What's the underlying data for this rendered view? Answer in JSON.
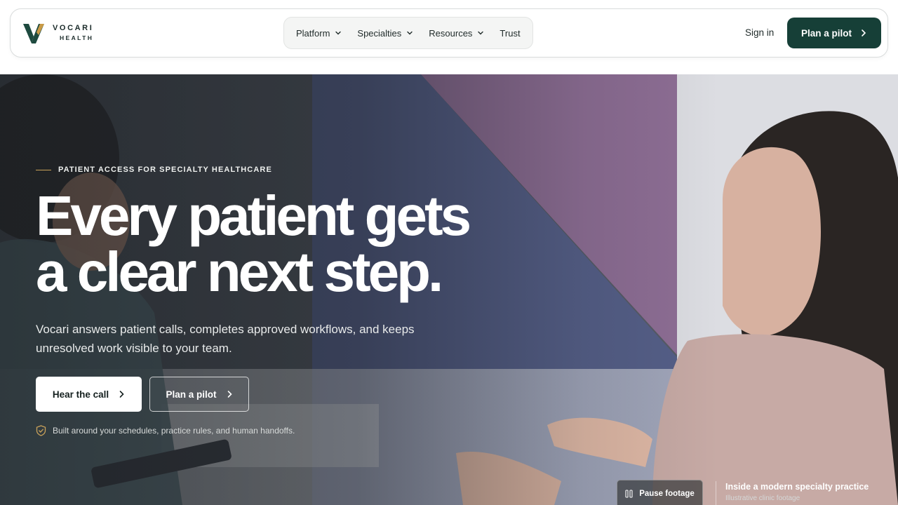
{
  "brand": {
    "name": "VOCARI",
    "sub": "HEALTH"
  },
  "nav": {
    "items": [
      {
        "label": "Platform",
        "has_dropdown": true
      },
      {
        "label": "Specialties",
        "has_dropdown": true
      },
      {
        "label": "Resources",
        "has_dropdown": true
      },
      {
        "label": "Trust",
        "has_dropdown": false
      }
    ],
    "signin_label": "Sign in",
    "cta_label": "Plan a pilot"
  },
  "hero": {
    "eyebrow": "PATIENT ACCESS FOR SPECIALTY HEALTHCARE",
    "headline_line1": "Every patient gets",
    "headline_line2": "a clear next step.",
    "subtext": "Vocari answers patient calls, completes approved workflows, and keeps unresolved work visible to your team.",
    "primary_cta": "Hear the call",
    "secondary_cta": "Plan a pilot",
    "assurance": "Built around your schedules, practice rules, and human handoffs."
  },
  "media": {
    "pause_label": "Pause footage",
    "caption_title": "Inside a modern specialty practice",
    "caption_sub": "Illustrative clinic footage"
  },
  "colors": {
    "brand_dark": "#163f37",
    "accent_gold": "#c9a25a",
    "logo_green": "#1e4a3f",
    "logo_gold": "#c99a45"
  },
  "icons": {
    "logo": "vocari-v-mark-icon",
    "dropdown": "chevron-down-icon",
    "arrow": "chevron-right-icon",
    "shield": "shield-check-icon",
    "pause": "pause-icon"
  }
}
